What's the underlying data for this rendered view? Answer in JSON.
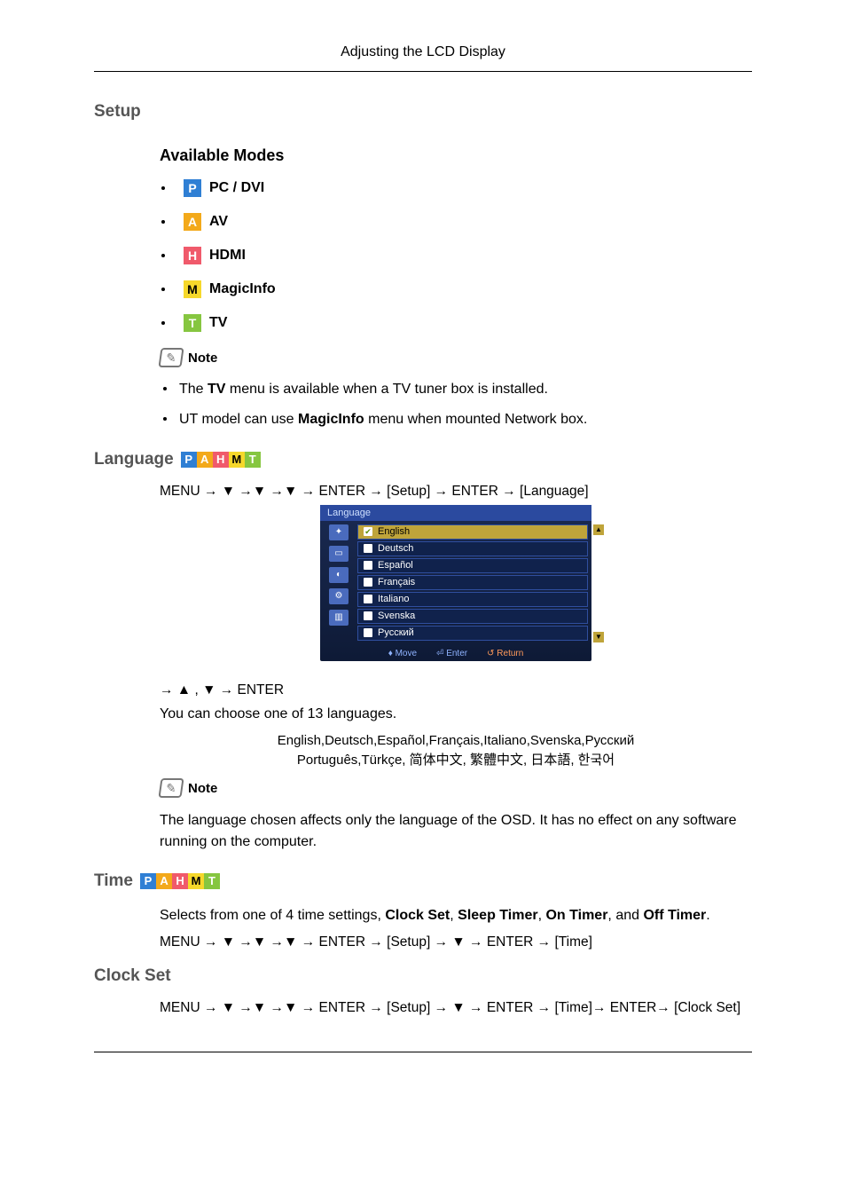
{
  "header": {
    "title": "Adjusting the LCD Display"
  },
  "setup": {
    "heading": "Setup"
  },
  "available_modes": {
    "heading": "Available Modes",
    "items": [
      {
        "letter": "P",
        "label": "PC / DVI"
      },
      {
        "letter": "A",
        "label": "AV"
      },
      {
        "letter": "H",
        "label": "HDMI"
      },
      {
        "letter": "M",
        "label": "MagicInfo"
      },
      {
        "letter": "T",
        "label": "TV"
      }
    ]
  },
  "note1": {
    "label": "Note",
    "items": [
      {
        "pre": "The ",
        "bold": "TV",
        "post": " menu is available when a TV tuner box is installed."
      },
      {
        "pre": "UT model can use ",
        "bold": "MagicInfo",
        "post": " menu when mounted Network box."
      }
    ]
  },
  "language": {
    "heading": "Language",
    "chips": [
      "P",
      "A",
      "H",
      "M",
      "T"
    ],
    "path": "MENU → ▼ →▼ →▼ → ENTER → [Setup] → ENTER → [Language]",
    "osd": {
      "title": "Language",
      "items": [
        "English",
        "Deutsch",
        "Español",
        "Français",
        "Italiano",
        "Svenska",
        "Русский"
      ],
      "selected_index": 0,
      "footer": {
        "move": "Move",
        "enter": "Enter",
        "return": "Return"
      }
    },
    "path2": "→ ▲ , ▼ → ENTER",
    "desc": "You can choose one of 13 languages.",
    "lang_line1": "English,Deutsch,Español,Français,Italiano,Svenska,Русский",
    "lang_line2": "Português,Türkçe, 简体中文,  繁體中文, 日本語, 한국어"
  },
  "note2": {
    "label": "Note",
    "text": "The language chosen affects only the language of the OSD. It has no effect on any software running on the computer."
  },
  "time": {
    "heading": "Time",
    "chips": [
      "P",
      "A",
      "H",
      "M",
      "T"
    ],
    "desc_pre": "Selects from one of 4 time settings, ",
    "desc_items": [
      "Clock Set",
      "Sleep Timer",
      "On Timer",
      "Off Timer"
    ],
    "desc_joins": [
      ", ",
      ", ",
      ", and "
    ],
    "desc_post": ".",
    "path": "MENU → ▼ →▼ →▼ → ENTER → [Setup] → ▼ → ENTER → [Time]"
  },
  "clock_set": {
    "heading": "Clock Set",
    "path": "MENU → ▼ →▼ →▼ → ENTER → [Setup] → ▼ → ENTER → [Time]→ ENTER→ [Clock Set]"
  }
}
